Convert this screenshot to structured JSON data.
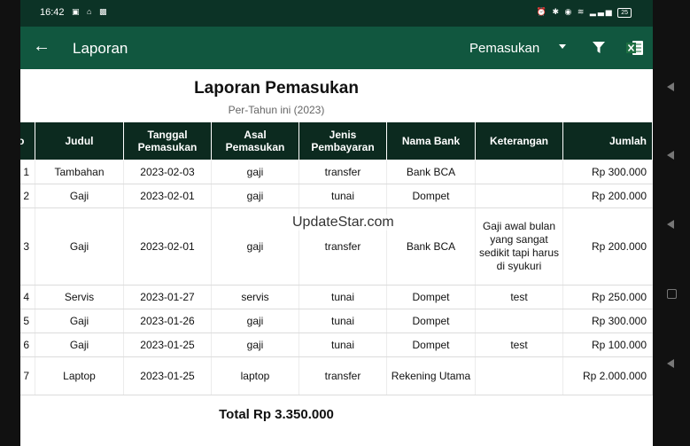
{
  "status": {
    "time": "16:42",
    "battery": "25"
  },
  "appbar": {
    "title": "Laporan",
    "filter": "Pemasukan"
  },
  "report": {
    "title": "Laporan Pemasukan",
    "subtitle": "Per-Tahun ini (2023)",
    "columns": [
      "No",
      "Judul",
      "Tanggal Pemasukan",
      "Asal Pemasukan",
      "Jenis Pembayaran",
      "Nama Bank",
      "Keterangan",
      "Jumlah"
    ],
    "rows": [
      {
        "no": "1",
        "judul": "Tambahan",
        "tanggal": "2023-02-03",
        "asal": "gaji",
        "jenis": "transfer",
        "bank": "Bank BCA",
        "ket": "",
        "jumlah": "Rp 300.000"
      },
      {
        "no": "2",
        "judul": "Gaji",
        "tanggal": "2023-02-01",
        "asal": "gaji",
        "jenis": "tunai",
        "bank": "Dompet",
        "ket": "",
        "jumlah": "Rp 200.000"
      },
      {
        "no": "3",
        "judul": "Gaji",
        "tanggal": "2023-02-01",
        "asal": "gaji",
        "jenis": "transfer",
        "bank": "Bank BCA",
        "ket": "Gaji awal bulan yang sangat sedikit tapi harus di syukuri",
        "jumlah": "Rp 200.000"
      },
      {
        "no": "4",
        "judul": "Servis",
        "tanggal": "2023-01-27",
        "asal": "servis",
        "jenis": "tunai",
        "bank": "Dompet",
        "ket": "test",
        "jumlah": "Rp 250.000"
      },
      {
        "no": "5",
        "judul": "Gaji",
        "tanggal": "2023-01-26",
        "asal": "gaji",
        "jenis": "tunai",
        "bank": "Dompet",
        "ket": "",
        "jumlah": "Rp 300.000"
      },
      {
        "no": "6",
        "judul": "Gaji",
        "tanggal": "2023-01-25",
        "asal": "gaji",
        "jenis": "tunai",
        "bank": "Dompet",
        "ket": "test",
        "jumlah": "Rp 100.000"
      },
      {
        "no": "7",
        "judul": "Laptop",
        "tanggal": "2023-01-25",
        "asal": "laptop",
        "jenis": "transfer",
        "bank": "Rekening Utama",
        "ket": "",
        "jumlah": "Rp 2.000.000"
      }
    ],
    "total": "Total Rp 3.350.000"
  },
  "watermark": "UpdateStar.com",
  "colors": {
    "appbar": "#11573f",
    "statusbar": "#0c3326",
    "table_header": "#0c2a1f"
  }
}
